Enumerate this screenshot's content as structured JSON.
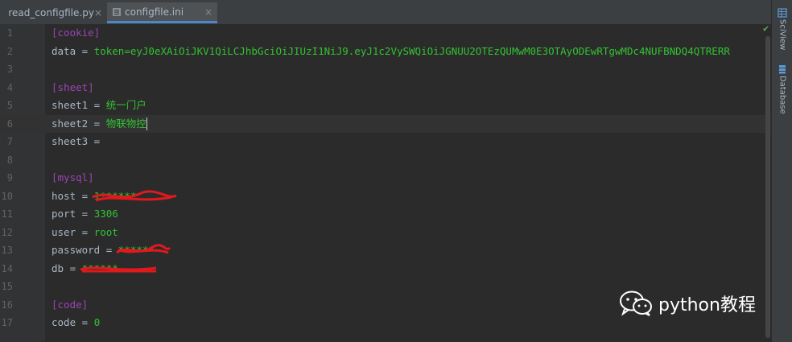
{
  "tabs": [
    {
      "label": "read_configfile.py",
      "close": "×"
    },
    {
      "label": "configfile.ini",
      "close": "×"
    }
  ],
  "right_tools": [
    {
      "label": "SciView",
      "icon": "sciview-icon"
    },
    {
      "label": "Database",
      "icon": "database-icon"
    }
  ],
  "lines": [
    {
      "num": "1",
      "section": "[cookie]"
    },
    {
      "num": "2",
      "key": "data = ",
      "value": "token=eyJ0eXAiOiJKV1QiLCJhbGciOiJIUzI1NiJ9.eyJ1c2VySWQiOiJGNUU2OTEzQUMwM0E3OTAyODEwRTgwMDc4NUFBNDQ4QTRERR"
    },
    {
      "num": "3"
    },
    {
      "num": "4",
      "section": "[sheet]"
    },
    {
      "num": "5",
      "key": "sheet1 = ",
      "value": "统一门户"
    },
    {
      "num": "6",
      "key": "sheet2 = ",
      "value": "物联物控"
    },
    {
      "num": "7",
      "key": "sheet3 = "
    },
    {
      "num": "8"
    },
    {
      "num": "9",
      "section": "[mysql]"
    },
    {
      "num": "10",
      "key": "host = ",
      "value": "1******"
    },
    {
      "num": "11",
      "key": "port = ",
      "value": "3306"
    },
    {
      "num": "12",
      "key": "user = ",
      "value": "root"
    },
    {
      "num": "13",
      "key": "password = ",
      "value": "******"
    },
    {
      "num": "14",
      "key": "db = ",
      "value": "******"
    },
    {
      "num": "15"
    },
    {
      "num": "16",
      "section": "[code]"
    },
    {
      "num": "17",
      "key": "code = ",
      "value": "0"
    }
  ],
  "watermark": {
    "text": "python教程"
  },
  "colors": {
    "section": "#9b44b5",
    "value": "#32c232",
    "redaction": "#e0191d"
  }
}
